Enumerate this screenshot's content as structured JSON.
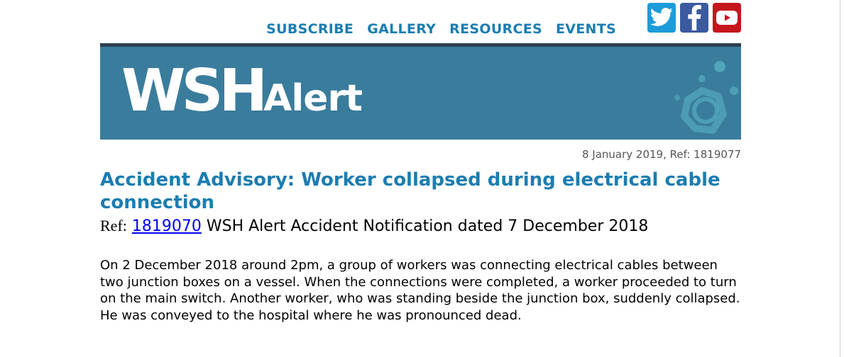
{
  "nav": {
    "items": [
      {
        "label": "SUBSCRIBE"
      },
      {
        "label": "GALLERY"
      },
      {
        "label": "RESOURCES"
      },
      {
        "label": "EVENTS"
      }
    ]
  },
  "social": [
    {
      "name": "twitter-icon"
    },
    {
      "name": "facebook-icon"
    },
    {
      "name": "youtube-icon"
    }
  ],
  "banner": {
    "logo_big": "WSH",
    "logo_small": "Alert"
  },
  "meta": {
    "date_ref": "8 January 2019, Ref: 1819077"
  },
  "article": {
    "title": "Accident Advisory: Worker collapsed during electrical cable connection",
    "ref_label": "Ref:",
    "ref_link": "1819070",
    "ref_text": " WSH Alert Accident Notification dated 7 December 2018",
    "body": "On 2 December 2018 around 2pm, a group of workers was connecting electrical cables between two junction boxes on a vessel. When the connections were completed, a worker proceeded to turn on the main switch. Another worker, who was standing beside the junction box, suddenly collapsed. He was conveyed to the hospital where he was pronounced dead."
  },
  "colors": {
    "accent": "#1b7db1",
    "banner": "#3a7c9c",
    "twitter": "#1d9bd9",
    "facebook": "#3b5aa0",
    "youtube": "#c4161c"
  }
}
